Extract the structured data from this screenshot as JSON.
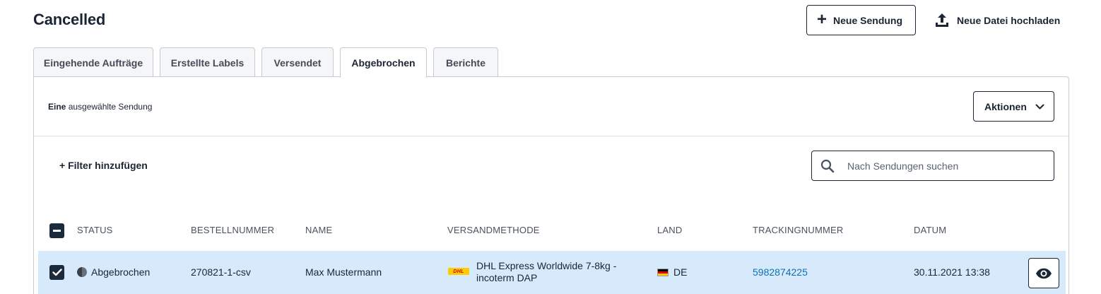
{
  "page": {
    "title": "Cancelled"
  },
  "header": {
    "new_shipment_label": "Neue Sendung",
    "upload_label": "Neue Datei hochladen"
  },
  "tabs": [
    {
      "label": "Eingehende Aufträge",
      "active": false
    },
    {
      "label": "Erstellte Labels",
      "active": false
    },
    {
      "label": "Versendet",
      "active": false
    },
    {
      "label": "Abgebrochen",
      "active": true
    },
    {
      "label": "Berichte",
      "active": false
    }
  ],
  "selection": {
    "count_word": "Eine",
    "suffix": "ausgewählte Sendung"
  },
  "actions": {
    "label": "Aktionen"
  },
  "filter": {
    "add_label": "+ Filter hinzufügen"
  },
  "search": {
    "placeholder": "Nach Sendungen suchen",
    "value": ""
  },
  "table": {
    "columns": [
      "STATUS",
      "BESTELLNUMMER",
      "NAME",
      "VERSANDMETHODE",
      "LAND",
      "TRACKINGNUMMER",
      "DATUM"
    ],
    "rows": [
      {
        "selected": true,
        "status": "Abgebrochen",
        "order_number": "270821-1-csv",
        "name": "Max Mustermann",
        "carrier_logo_text": "DHL",
        "method_line1": "DHL Express Worldwide 7-8kg -",
        "method_line2": "incoterm DAP",
        "country": "DE",
        "tracking": "5982874225",
        "date": "30.11.2021 13:38"
      }
    ]
  },
  "colors": {
    "text": "#1b2533",
    "row_selected_bg": "#d6eafb",
    "link": "#0f6fb3",
    "checkbox": "#1b2a3d"
  }
}
